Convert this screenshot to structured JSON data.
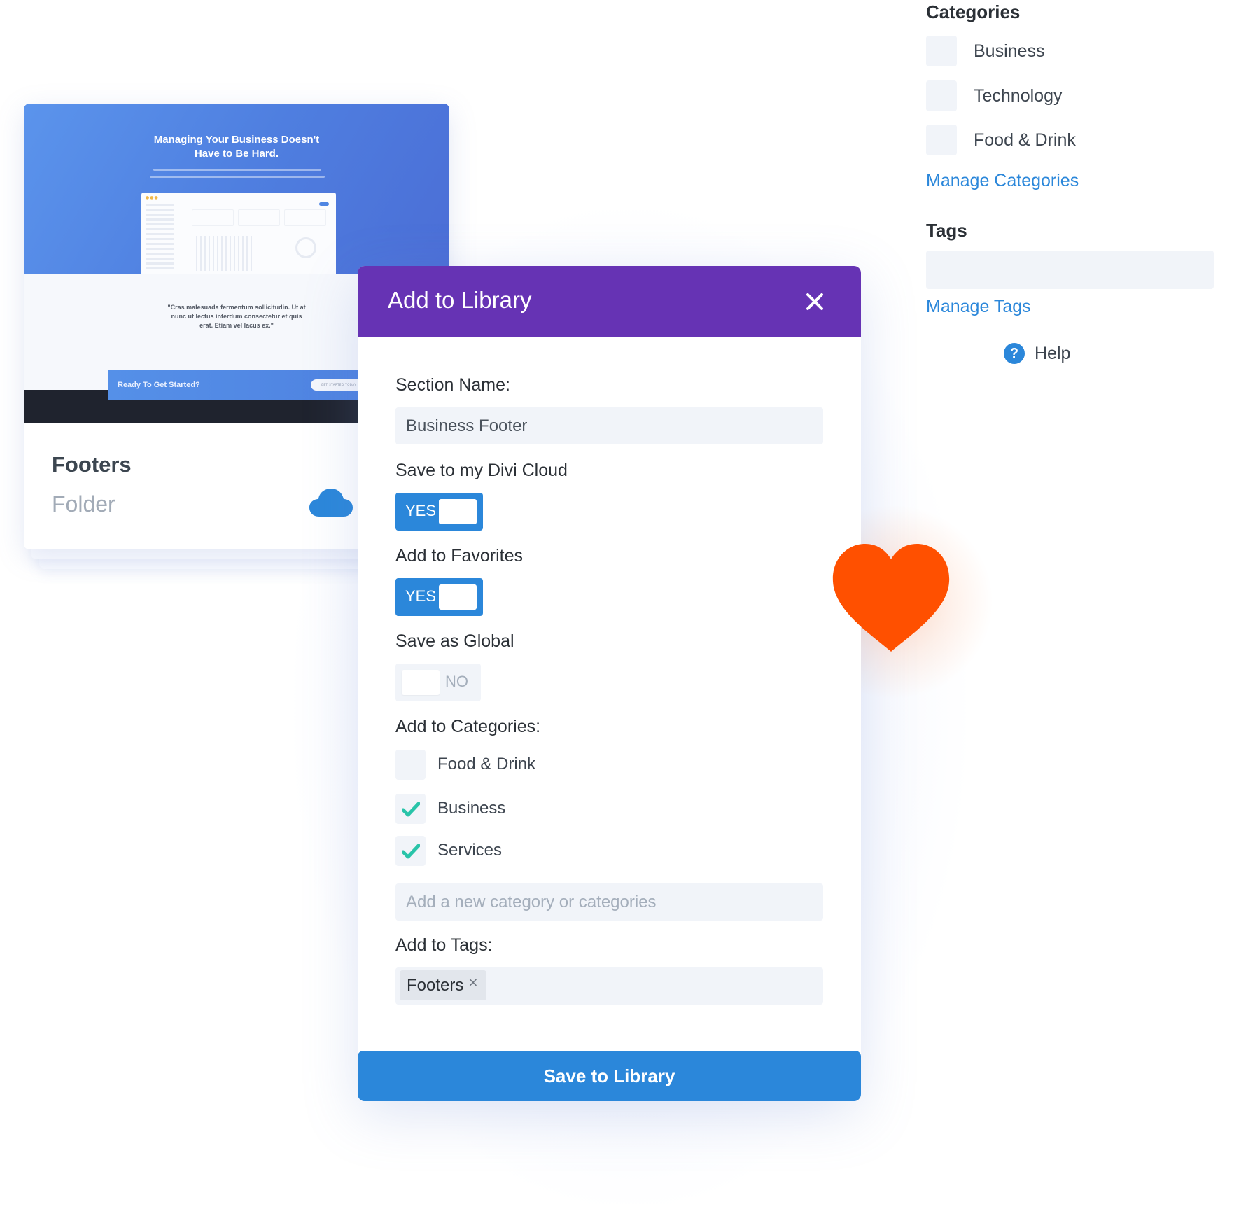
{
  "library_card": {
    "preview": {
      "headline_line1": "Managing Your Business Doesn't",
      "headline_line2": "Have to Be Hard.",
      "quote_line1": "\"Cras malesuada fermentum sollicitudin. Ut at",
      "quote_line2": "nunc ut lectus interdum consectetur et quis",
      "quote_line3": "erat. Etiam vel lacus ex.\"",
      "cta_text": "Ready To Get Started?",
      "cta_button": "GET STARTED TODAY"
    },
    "title": "Footers",
    "subtitle": "Folder",
    "icon": "cloud-icon"
  },
  "modal": {
    "title": "Add to Library",
    "close_icon": "close-icon",
    "section_name": {
      "label": "Section Name:",
      "value": "Business Footer"
    },
    "toggles": [
      {
        "label": "Save to my Divi Cloud",
        "state": "YES",
        "on": true
      },
      {
        "label": "Add to Favorites",
        "state": "YES",
        "on": true
      },
      {
        "label": "Save as Global",
        "state": "NO",
        "on": false
      }
    ],
    "categories": {
      "label": "Add to Categories:",
      "items": [
        {
          "label": "Food & Drink",
          "checked": false
        },
        {
          "label": "Business",
          "checked": true
        },
        {
          "label": "Services",
          "checked": true
        }
      ],
      "new_placeholder": "Add a new category or categories"
    },
    "tags": {
      "label": "Add to Tags:",
      "items": [
        {
          "label": "Footers",
          "remove_glyph": "×"
        }
      ]
    },
    "save_label": "Save to Library"
  },
  "favorite": {
    "icon": "heart-icon",
    "color": "#ff5000"
  },
  "sidebar": {
    "categories_heading": "Categories",
    "categories": [
      {
        "label": "Business",
        "checked": false
      },
      {
        "label": "Technology",
        "checked": false
      },
      {
        "label": "Food & Drink",
        "checked": false
      }
    ],
    "manage_categories": "Manage Categories",
    "tags_heading": "Tags",
    "tags_value": "",
    "manage_tags": "Manage Tags",
    "help_glyph": "?",
    "help_label": "Help"
  },
  "colors": {
    "modal_header": "#6633b4",
    "primary_blue": "#2b87da",
    "check_green": "#29c4a9",
    "field_bg": "#f1f4f9",
    "heart": "#ff5000"
  }
}
